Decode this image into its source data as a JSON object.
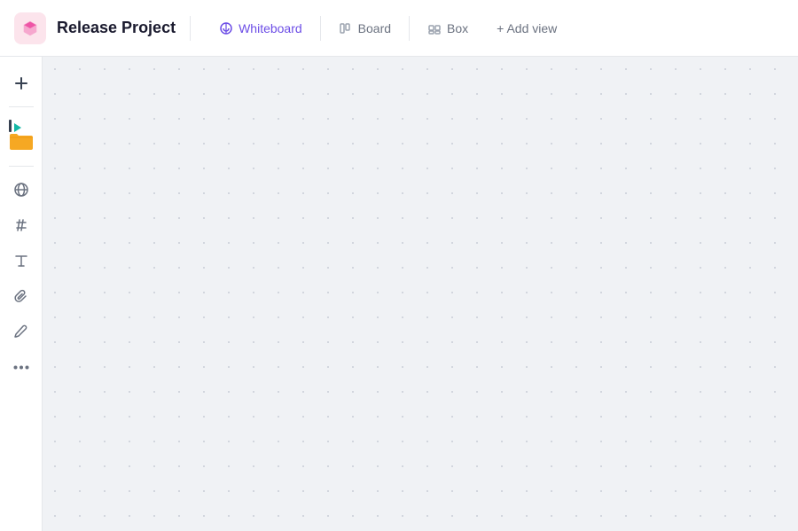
{
  "header": {
    "project_title": "Release Project",
    "tabs": [
      {
        "id": "whiteboard",
        "label": "Whiteboard",
        "active": true,
        "icon": "whiteboard-icon"
      },
      {
        "id": "board",
        "label": "Board",
        "active": false,
        "icon": "board-icon"
      },
      {
        "id": "box",
        "label": "Box",
        "active": false,
        "icon": "box-icon"
      }
    ],
    "add_view_label": "+ Add view"
  },
  "toolbar": {
    "buttons": [
      {
        "id": "add",
        "icon": "plus-icon",
        "label": "Add"
      },
      {
        "id": "media",
        "icon": "media-icon",
        "label": "Media"
      },
      {
        "id": "sticker",
        "icon": "sticker-icon",
        "label": "Sticker"
      },
      {
        "id": "globe",
        "icon": "globe-icon",
        "label": "Globe"
      },
      {
        "id": "hash",
        "icon": "hash-icon",
        "label": "Hash"
      },
      {
        "id": "text",
        "icon": "text-icon",
        "label": "Text"
      },
      {
        "id": "attach",
        "icon": "attach-icon",
        "label": "Attach"
      },
      {
        "id": "draw",
        "icon": "draw-icon",
        "label": "Draw"
      },
      {
        "id": "more",
        "icon": "more-icon",
        "label": "More"
      }
    ]
  },
  "canvas": {
    "background": "#f0f2f5",
    "dot_color": "#c8cdd6"
  },
  "colors": {
    "active_tab": "#6c4de6",
    "icon_color": "#6b7280",
    "border": "#e5e7eb",
    "teal": "#14b8a6",
    "amber": "#f59e0b",
    "project_icon_bg": "#fce4ec",
    "project_icon_color": "#e91e8c"
  }
}
